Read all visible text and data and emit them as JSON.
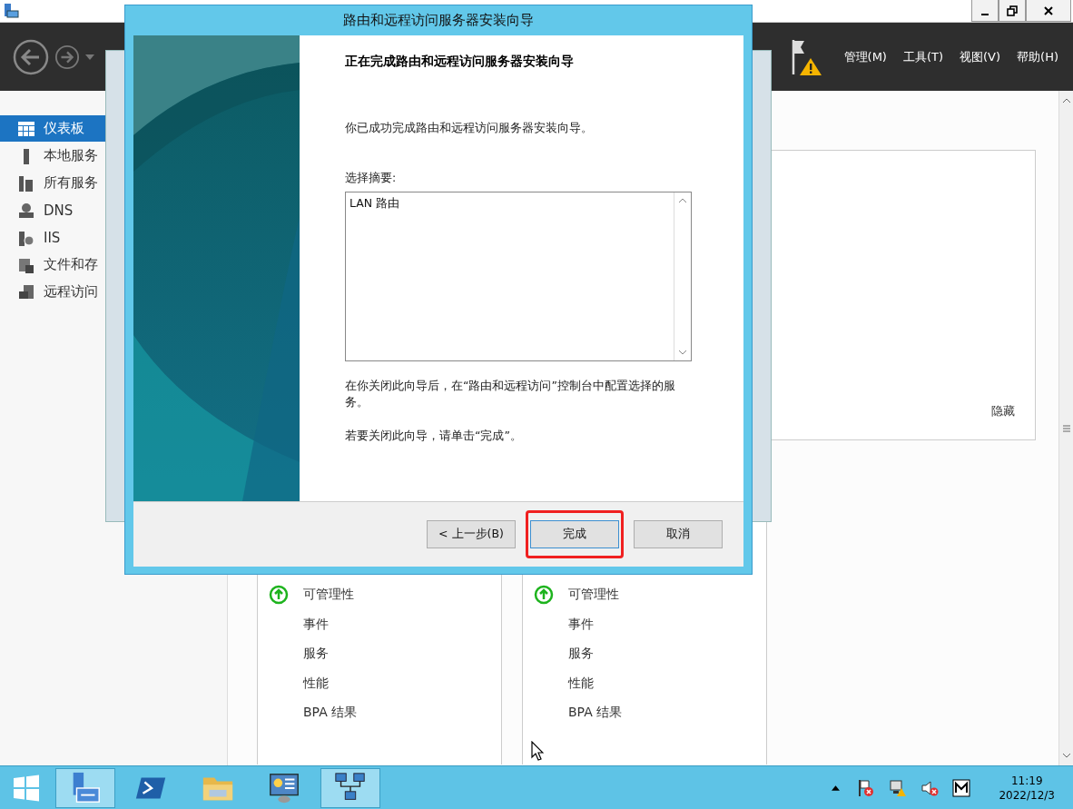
{
  "app_window": {
    "menu": [
      {
        "label": "管理(M)"
      },
      {
        "label": "工具(T)"
      },
      {
        "label": "视图(V)"
      },
      {
        "label": "帮助(H)"
      }
    ],
    "warning": true
  },
  "sidebar": {
    "items": [
      {
        "label": "仪表板",
        "kind": "dashboard",
        "selected": true
      },
      {
        "label": "本地服务",
        "kind": "server",
        "selected": false
      },
      {
        "label": "所有服务",
        "kind": "servers",
        "selected": false
      },
      {
        "label": "DNS",
        "kind": "dns",
        "selected": false
      },
      {
        "label": "IIS",
        "kind": "iis",
        "selected": false
      },
      {
        "label": "文件和存",
        "kind": "files",
        "selected": false
      },
      {
        "label": "远程访问",
        "kind": "remote",
        "selected": false
      }
    ]
  },
  "panel": {
    "hide_link": "隐藏"
  },
  "tiles": [
    {
      "items": [
        {
          "label": "可管理性",
          "ok": true
        },
        {
          "label": "事件",
          "ok": false
        },
        {
          "label": "服务",
          "ok": false
        },
        {
          "label": "性能",
          "ok": false
        },
        {
          "label": "BPA 结果",
          "ok": false
        }
      ]
    },
    {
      "items": [
        {
          "label": "可管理性",
          "ok": true
        },
        {
          "label": "事件",
          "ok": false
        },
        {
          "label": "服务",
          "ok": false
        },
        {
          "label": "性能",
          "ok": false
        },
        {
          "label": "BPA 结果",
          "ok": false
        }
      ]
    }
  ],
  "dialog": {
    "title": "路由和远程访问服务器安装向导",
    "heading": "正在完成路由和远程访问服务器安装向导",
    "message": "你已成功完成路由和远程访问服务器安装向导。",
    "summary_label": "选择摘要:",
    "summary_items": [
      "LAN 路由"
    ],
    "note": "在你关闭此向导后，在“路由和远程访问”控制台中配置选择的服务。",
    "close_hint": "若要关闭此向导，请单击“完成”。",
    "buttons": [
      {
        "label": "< 上一步(B)",
        "focused": false,
        "marked": false
      },
      {
        "label": "完成",
        "focused": true,
        "marked": true
      },
      {
        "label": "取消",
        "focused": false,
        "marked": false
      }
    ]
  },
  "taskbar": {
    "apps": [
      {
        "kind": "server-manager",
        "selected": true
      },
      {
        "kind": "powershell",
        "selected": false
      },
      {
        "kind": "explorer",
        "selected": false
      },
      {
        "kind": "control-panel",
        "selected": false
      },
      {
        "kind": "network",
        "selected": true
      }
    ],
    "time": "11:19",
    "date": "2022/12/3"
  }
}
